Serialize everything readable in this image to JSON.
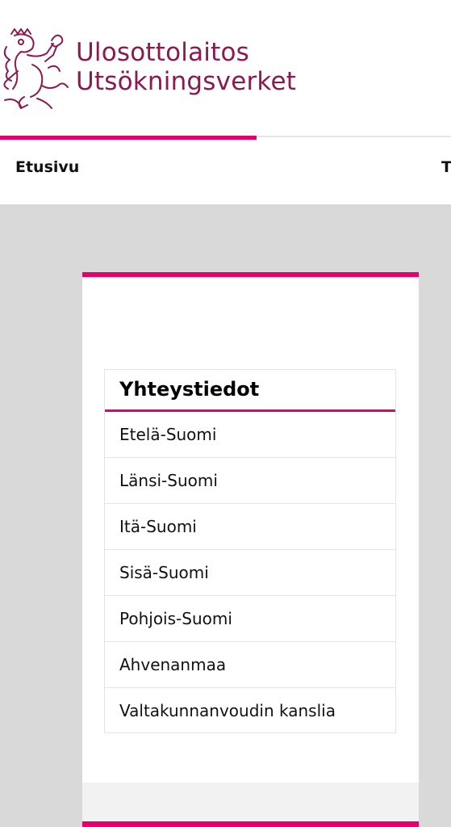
{
  "header": {
    "logo_line1": "Ulosottolaitos",
    "logo_line2": "Utsökningsverket",
    "logo_icon": "finnish-lion-emblem"
  },
  "nav": {
    "items": [
      {
        "label": "Etusivu"
      },
      {
        "label": "T"
      }
    ]
  },
  "contacts": {
    "title": "Yhteystiedot",
    "items": [
      {
        "label": "Etelä-Suomi"
      },
      {
        "label": "Länsi-Suomi"
      },
      {
        "label": "Itä-Suomi"
      },
      {
        "label": "Sisä-Suomi"
      },
      {
        "label": "Pohjois-Suomi"
      },
      {
        "label": "Ahvenanmaa"
      },
      {
        "label": "Valtakunnanvoudin kanslia"
      }
    ]
  },
  "colors": {
    "brand": "#8a1a4f",
    "accent": "#e5006d",
    "background": "#d9d9d9"
  }
}
